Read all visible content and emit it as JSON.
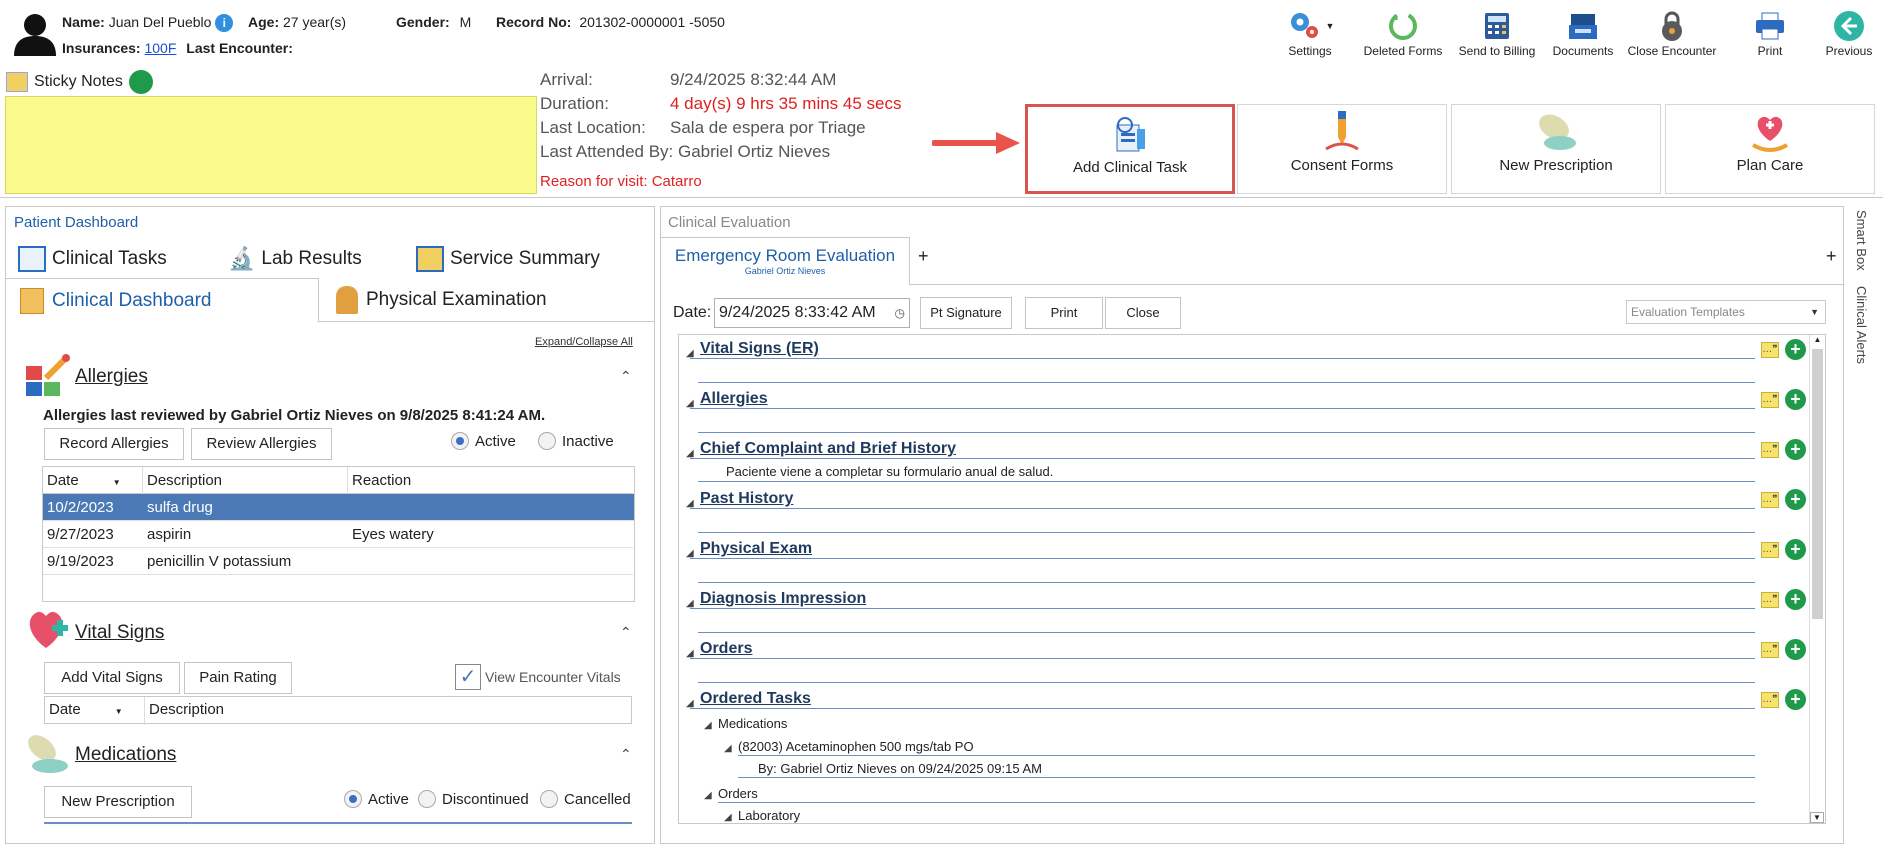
{
  "header": {
    "name_label": "Name:",
    "name": "Juan Del Pueblo",
    "age_label": "Age:",
    "age": "27 year(s)",
    "gender_label": "Gender:",
    "gender": "M",
    "record_label": "Record No:",
    "record": "201302-0000001 -5050",
    "insurances_label": "Insurances:",
    "insurance_link": "100F",
    "last_encounter_label": "Last Encounter:"
  },
  "toolbar": [
    {
      "label": "Settings",
      "icon": "gears-icon"
    },
    {
      "label": "Deleted Forms",
      "icon": "recycle-icon"
    },
    {
      "label": "Send to Billing",
      "icon": "calculator-icon"
    },
    {
      "label": "Documents",
      "icon": "tray-icon"
    },
    {
      "label": "Close Encounter",
      "icon": "padlock-icon"
    },
    {
      "label": "Print",
      "icon": "printer-icon"
    },
    {
      "label": "Previous",
      "icon": "arrow-left-icon"
    }
  ],
  "sticky": {
    "label": "Sticky Notes"
  },
  "visit": {
    "arrival_label": "Arrival:",
    "arrival": "9/24/2025 8:32:44 AM",
    "duration_label": "Duration:",
    "duration": "4 day(s) 9 hrs 35 mins 45 secs",
    "location_label": "Last Location:",
    "location": "Sala de espera por Triage",
    "attended": "Last Attended By: Gabriel Ortiz Nieves",
    "reason": "Reason for visit: Catarro"
  },
  "actions": [
    {
      "label": "Add Clinical Task"
    },
    {
      "label": "Consent Forms"
    },
    {
      "label": "New Prescription"
    },
    {
      "label": "Plan Care"
    }
  ],
  "dashboard": {
    "title": "Patient Dashboard",
    "tabs": [
      "Clinical Tasks",
      "Lab Results",
      "Service Summary",
      "Clinical Dashboard",
      "Physical Examination"
    ],
    "expand": "Expand/Collapse All",
    "allergies": {
      "title": "Allergies",
      "reviewed": "Allergies last reviewed by Gabriel Ortiz Nieves on 9/8/2025 8:41:24 AM.",
      "record_btn": "Record Allergies",
      "review_btn": "Review Allergies",
      "active": "Active",
      "inactive": "Inactive",
      "columns": [
        "Date",
        "Description",
        "Reaction"
      ],
      "rows": [
        {
          "date": "10/2/2023",
          "desc": "sulfa drug",
          "reaction": ""
        },
        {
          "date": "9/27/2023",
          "desc": "aspirin",
          "reaction": "Eyes watery"
        },
        {
          "date": "9/19/2023",
          "desc": "penicillin V potassium",
          "reaction": ""
        }
      ]
    },
    "vitals": {
      "title": "Vital Signs",
      "add_btn": "Add Vital Signs",
      "pain_btn": "Pain Rating",
      "view_label": "View Encounter Vitals",
      "columns": [
        "Date",
        "Description"
      ]
    },
    "meds": {
      "title": "Medications",
      "new_btn": "New Prescription",
      "active": "Active",
      "discontinued": "Discontinued",
      "cancelled": "Cancelled"
    }
  },
  "evaluation": {
    "panel_title": "Clinical Evaluation",
    "tab": "Emergency Room Evaluation",
    "tab_sub": "Gabriel Ortiz Nieves",
    "date_label": "Date:",
    "date_value": "9/24/2025 8:33:42 AM",
    "pt_signature": "Pt Signature",
    "print": "Print",
    "close": "Close",
    "templates_placeholder": "Evaluation Templates",
    "sections": [
      {
        "title": "Vital Signs (ER)"
      },
      {
        "title": "Allergies"
      },
      {
        "title": "Chief Complaint and Brief History"
      },
      {
        "title": "Past History"
      },
      {
        "title": "Physical Exam"
      },
      {
        "title": "Diagnosis Impression"
      },
      {
        "title": "Orders"
      },
      {
        "title": "Ordered Tasks"
      }
    ],
    "chief_text": "Paciente viene a completar su formulario anual de salud.",
    "tasks": {
      "medications": "Medications",
      "med_item": "(82003) Acetaminophen 500 mgs/tab PO",
      "med_by": "By: Gabriel Ortiz Nieves on 09/24/2025 09:15 AM",
      "orders": "Orders",
      "laboratory": "Laboratory"
    }
  },
  "side_tabs": [
    "Smart Box",
    "Clinical Alerts"
  ]
}
